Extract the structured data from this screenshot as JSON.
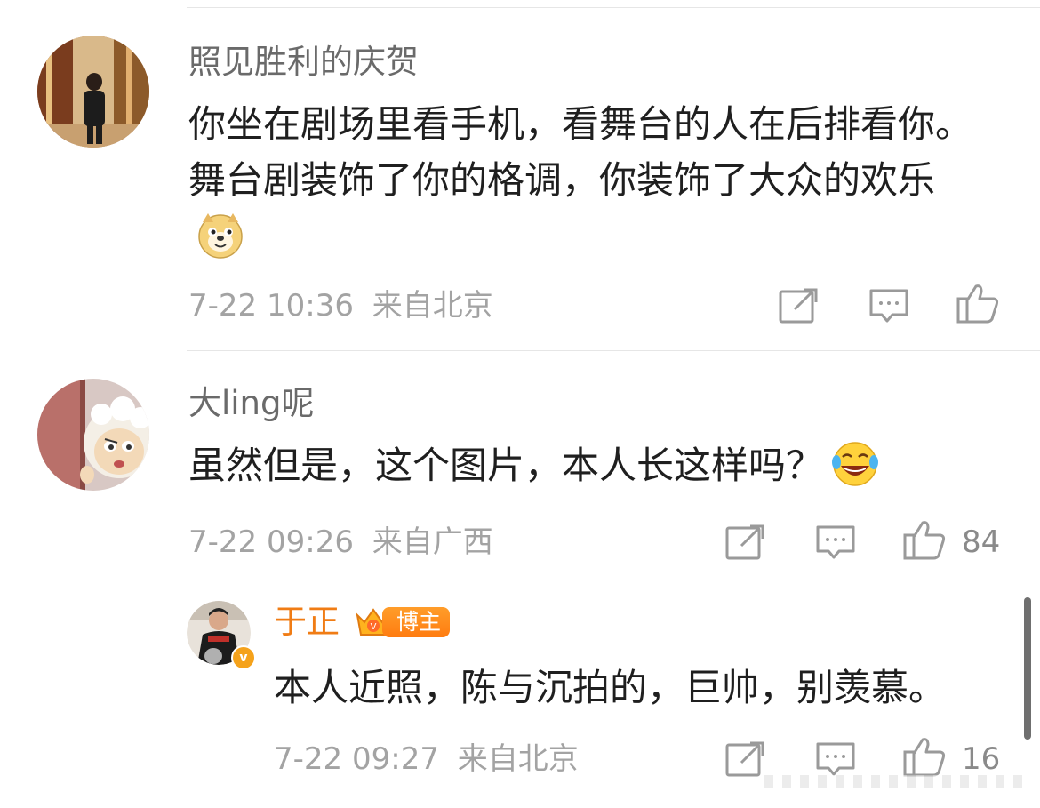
{
  "comments": [
    {
      "username": "照见胜利的庆贺",
      "text": "你坐在剧场里看手机，看舞台的人在后排看你。舞台剧装饰了你的格调，你装饰了大众的欢乐",
      "emoji": "doge-emoji",
      "time": "7-22 10:36",
      "location": "来自北京",
      "likes": ""
    },
    {
      "username": "大ling呢",
      "text": "虽然但是，这个图片，本人长这样吗？",
      "emoji": "laughing-tears-emoji",
      "time": "7-22 09:26",
      "location": "来自广西",
      "likes": "84"
    }
  ],
  "reply": {
    "username": "于正",
    "badge": "博主",
    "text": "本人近照，陈与沉拍的，巨帅，别羡慕。",
    "time": "7-22 09:27",
    "location": "来自北京",
    "likes": "16"
  },
  "colors": {
    "username": "#6a6a6a",
    "blogger_name": "#f07c14",
    "text": "#1f1f1f",
    "meta": "#a3a3a3",
    "icon": "#9a9a9a"
  },
  "icons": [
    "repost-icon",
    "comment-icon",
    "like-icon"
  ]
}
